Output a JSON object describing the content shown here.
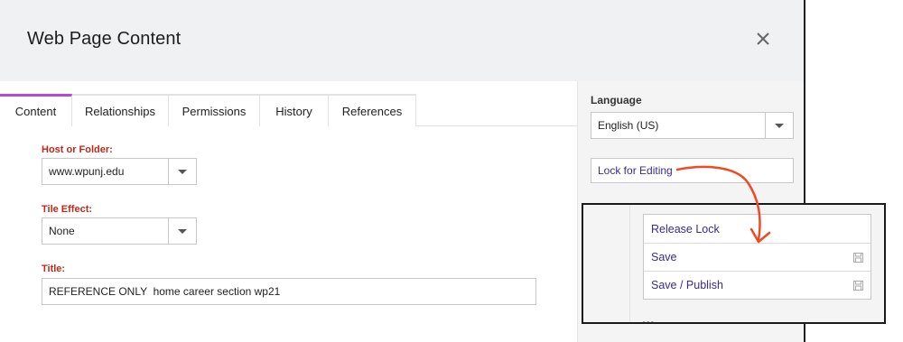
{
  "dialog": {
    "title": "Web Page Content",
    "close_icon": "close-icon"
  },
  "tabs": [
    {
      "label": "Content",
      "active": true
    },
    {
      "label": "Relationships"
    },
    {
      "label": "Permissions"
    },
    {
      "label": "History"
    },
    {
      "label": "References"
    }
  ],
  "form": {
    "host": {
      "label": "Host or Folder:",
      "value": "www.wpunj.edu"
    },
    "tile": {
      "label": "Tile Effect:",
      "value": "None"
    },
    "title": {
      "label": "Title:",
      "value": "REFERENCE ONLY  home career section wp21"
    }
  },
  "sidebar": {
    "language_label": "Language",
    "language_value": "English (US)",
    "lock_button": "Lock for Editing"
  },
  "inset_menu": {
    "items": [
      {
        "label": "Release Lock",
        "icon": null
      },
      {
        "label": "Save",
        "icon": "save-icon"
      },
      {
        "label": "Save / Publish",
        "icon": "save-icon"
      }
    ],
    "partial_text": "Wo"
  },
  "colors": {
    "active_tab_accent": "#b04ad7",
    "required_label": "#c2271a",
    "action_text": "#3b2b8e",
    "annotation_arrow": "#f04a23"
  }
}
